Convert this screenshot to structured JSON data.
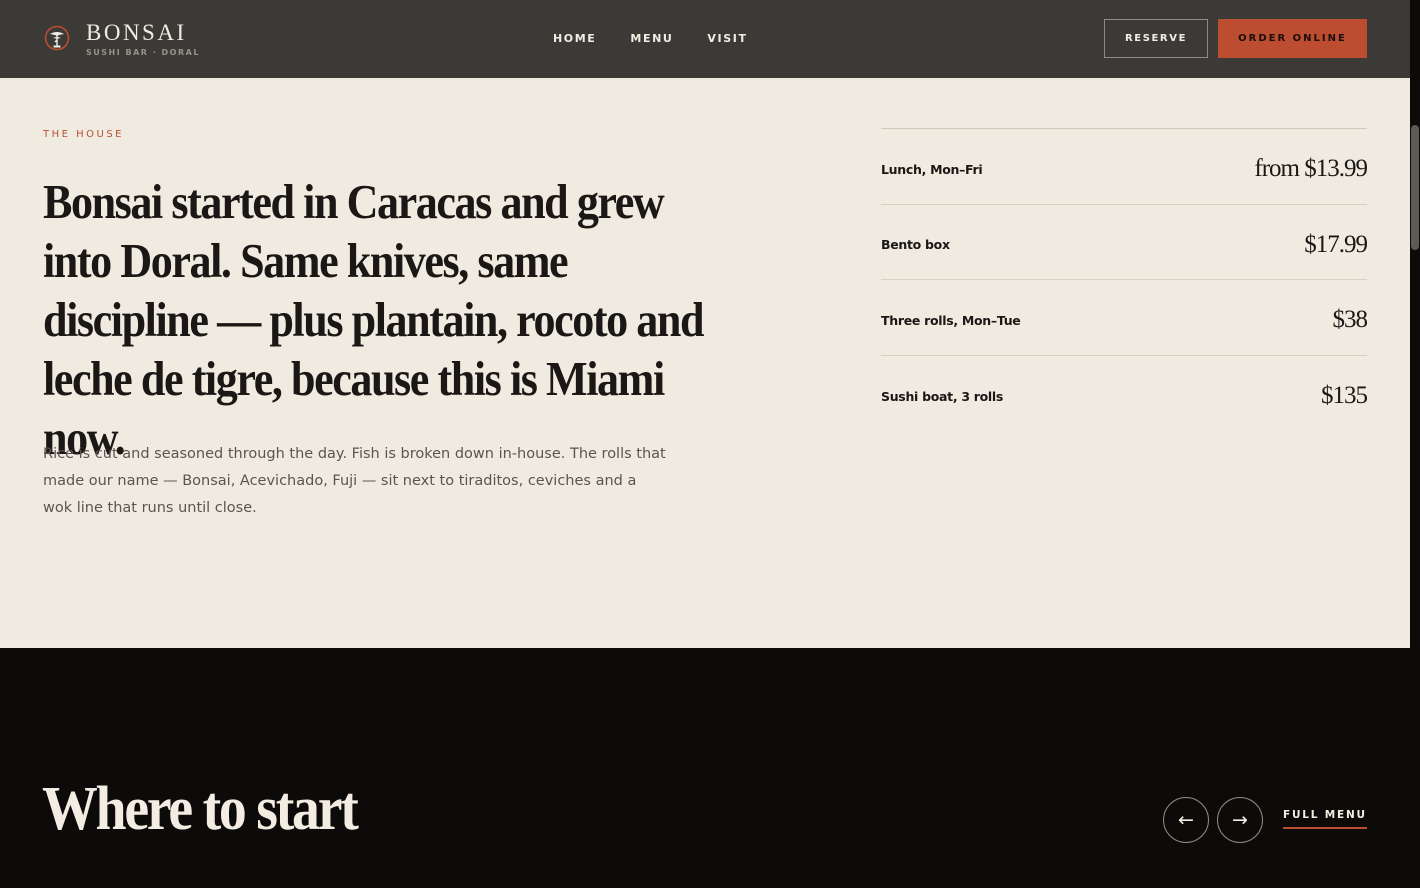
{
  "brand": {
    "name": "BONSAI",
    "tagline": "SUSHI BAR · DORAL",
    "icon": "bonsai-tree-icon"
  },
  "nav": {
    "items": [
      {
        "label": "HOME"
      },
      {
        "label": "MENU"
      },
      {
        "label": "VISIT"
      }
    ]
  },
  "header_actions": {
    "reserve_label": "RESERVE",
    "order_label": "ORDER ONLINE"
  },
  "house": {
    "eyebrow": "THE HOUSE",
    "headline": "Bonsai started in Caracas and grew into Doral. Same knives, same discipline — plus plantain, rocoto and leche de tigre, because this is Miami now.",
    "body": "Rice is cut and seasoned through the day. Fish is broken down in-house. The rolls that made our name — Bonsai, Acevichado, Fuji — sit next to tiraditos, ceviches and a wok line that runs until close.",
    "prices": [
      {
        "label": "Lunch, Mon–Fri",
        "value": "from $13.99"
      },
      {
        "label": "Bento box",
        "value": "$17.99"
      },
      {
        "label": "Three rolls, Mon–Tue",
        "value": "$38"
      },
      {
        "label": "Sushi boat, 3 rolls",
        "value": "$135"
      }
    ]
  },
  "start": {
    "title": "Where to start",
    "prev_icon": "arrow-left-icon",
    "next_icon": "arrow-right-icon",
    "prev_glyph": "←",
    "next_glyph": "→",
    "full_menu_label": "FULL MENU"
  },
  "colors": {
    "header_bg": "#3c3a37",
    "accent": "#bc4d31",
    "cream": "#f0ebe1",
    "dark": "#0d0b0a"
  }
}
